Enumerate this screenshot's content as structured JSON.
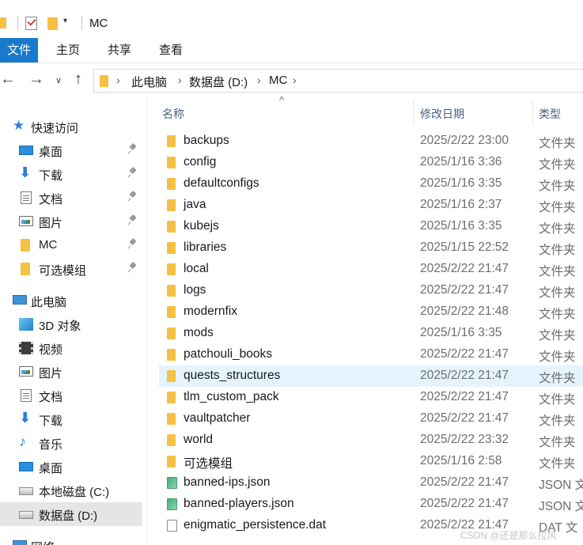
{
  "window": {
    "title": "MC"
  },
  "quick_access_toolbar": {
    "dropdown_glyph": "▾"
  },
  "ribbon": {
    "tabs": [
      "文件",
      "主页",
      "共享",
      "查看"
    ]
  },
  "address": {
    "crumbs": [
      "此电脑",
      "数据盘 (D:)",
      "MC"
    ]
  },
  "sidebar": {
    "items": [
      {
        "label": "快速访问",
        "icon": "star-icon",
        "root": true
      },
      {
        "label": "桌面",
        "icon": "desktop-icon",
        "pinned": true
      },
      {
        "label": "下载",
        "icon": "download-icon",
        "pinned": true
      },
      {
        "label": "文档",
        "icon": "document-icon",
        "pinned": true
      },
      {
        "label": "图片",
        "icon": "picture-icon",
        "pinned": true
      },
      {
        "label": "MC",
        "icon": "folder-icon",
        "pinned": true
      },
      {
        "label": "可选模组",
        "icon": "folder-icon",
        "pinned": true
      },
      {
        "label": "此电脑",
        "icon": "this-pc-icon",
        "root": true
      },
      {
        "label": "3D 对象",
        "icon": "3d-objects-icon"
      },
      {
        "label": "视频",
        "icon": "video-icon"
      },
      {
        "label": "图片",
        "icon": "picture-icon"
      },
      {
        "label": "文档",
        "icon": "document-icon"
      },
      {
        "label": "下载",
        "icon": "download-icon"
      },
      {
        "label": "音乐",
        "icon": "music-icon"
      },
      {
        "label": "桌面",
        "icon": "desktop-icon"
      },
      {
        "label": "本地磁盘 (C:)",
        "icon": "drive-icon"
      },
      {
        "label": "数据盘 (D:)",
        "icon": "drive-icon",
        "selected": true
      },
      {
        "label": "网络",
        "icon": "network-icon",
        "root": true
      }
    ]
  },
  "columns": {
    "name": "名称",
    "modified": "修改日期",
    "type": "类型"
  },
  "files": [
    {
      "name": "backups",
      "modified": "2025/2/22 23:00",
      "type": "文件夹",
      "kind": "folder"
    },
    {
      "name": "config",
      "modified": "2025/1/16 3:36",
      "type": "文件夹",
      "kind": "folder"
    },
    {
      "name": "defaultconfigs",
      "modified": "2025/1/16 3:35",
      "type": "文件夹",
      "kind": "folder"
    },
    {
      "name": "java",
      "modified": "2025/1/16 2:37",
      "type": "文件夹",
      "kind": "folder"
    },
    {
      "name": "kubejs",
      "modified": "2025/1/16 3:35",
      "type": "文件夹",
      "kind": "folder"
    },
    {
      "name": "libraries",
      "modified": "2025/1/15 22:52",
      "type": "文件夹",
      "kind": "folder"
    },
    {
      "name": "local",
      "modified": "2025/2/22 21:47",
      "type": "文件夹",
      "kind": "folder"
    },
    {
      "name": "logs",
      "modified": "2025/2/22 21:47",
      "type": "文件夹",
      "kind": "folder"
    },
    {
      "name": "modernfix",
      "modified": "2025/2/22 21:48",
      "type": "文件夹",
      "kind": "folder"
    },
    {
      "name": "mods",
      "modified": "2025/1/16 3:35",
      "type": "文件夹",
      "kind": "folder"
    },
    {
      "name": "patchouli_books",
      "modified": "2025/2/22 21:47",
      "type": "文件夹",
      "kind": "folder"
    },
    {
      "name": "quests_structures",
      "modified": "2025/2/22 21:47",
      "type": "文件夹",
      "kind": "folder",
      "hover": true
    },
    {
      "name": "tlm_custom_pack",
      "modified": "2025/2/22 21:47",
      "type": "文件夹",
      "kind": "folder"
    },
    {
      "name": "vaultpatcher",
      "modified": "2025/2/22 21:47",
      "type": "文件夹",
      "kind": "folder"
    },
    {
      "name": "world",
      "modified": "2025/2/22 23:32",
      "type": "文件夹",
      "kind": "folder"
    },
    {
      "name": "可选模组",
      "modified": "2025/1/16 2:58",
      "type": "文件夹",
      "kind": "folder"
    },
    {
      "name": "banned-ips.json",
      "modified": "2025/2/22 21:47",
      "type": "JSON 文",
      "kind": "json"
    },
    {
      "name": "banned-players.json",
      "modified": "2025/2/22 21:47",
      "type": "JSON 文",
      "kind": "json"
    },
    {
      "name": "enigmatic_persistence.dat",
      "modified": "2025/2/22 21:47",
      "type": "DAT 文",
      "kind": "dat"
    }
  ],
  "watermark": "CSDN @还是那么拉风"
}
